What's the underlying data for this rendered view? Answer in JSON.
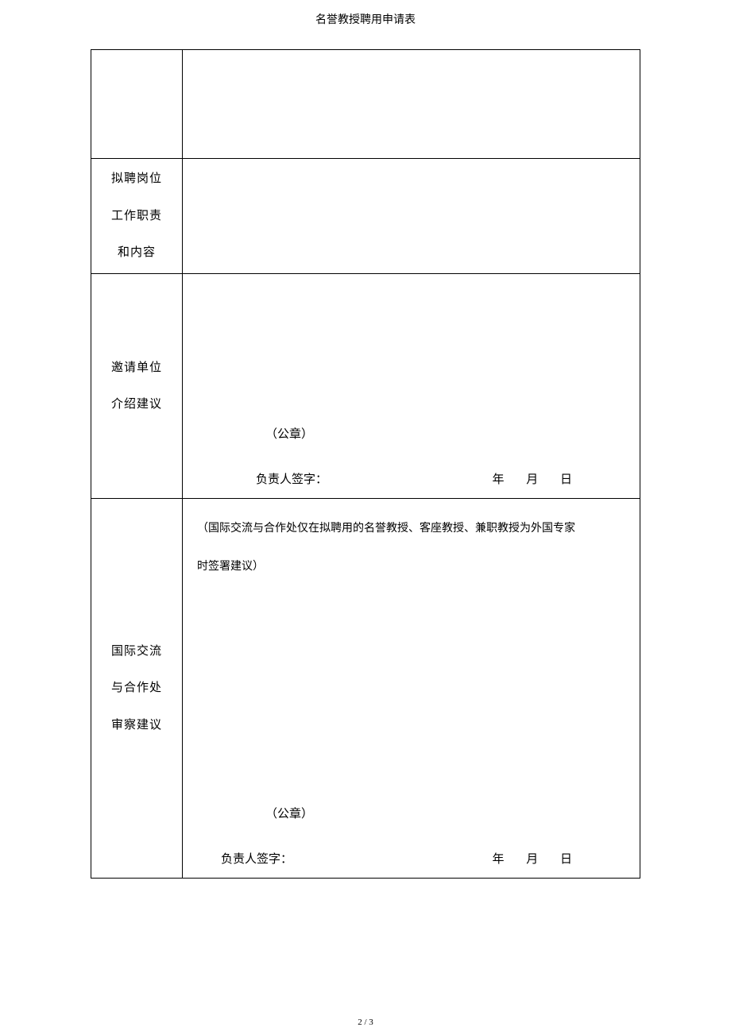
{
  "header": {
    "title": "名誉教授聘用申请表"
  },
  "rows": {
    "row2_label_line1": "拟聘岗位",
    "row2_label_line2": "工作职责",
    "row2_label_line3": "和内容",
    "row3_label_line1": "邀请单位",
    "row3_label_line2": "介绍建议",
    "row4_label_line1": "国际交流",
    "row4_label_line2": "与合作处",
    "row4_label_line3": "审察建议"
  },
  "common": {
    "seal": "（公章）",
    "signature_label": "负责人签字：",
    "year": "年",
    "month": "月",
    "day": "日"
  },
  "row4_note": {
    "line1": "（国际交流与合作处仅在拟聘用的名誉教授、客座教授、兼职教授为外国专家",
    "line2": "时签署建议）"
  },
  "footer": {
    "page_number": "2 / 3"
  }
}
